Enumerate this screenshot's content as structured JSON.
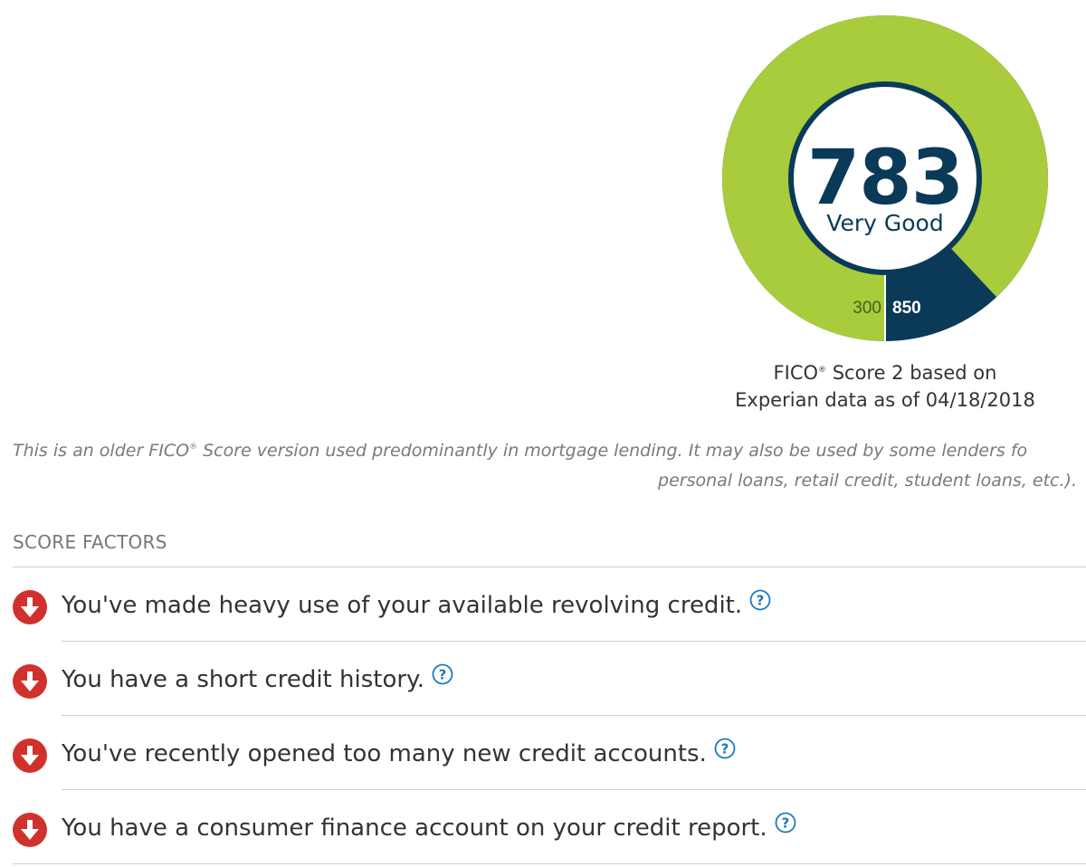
{
  "score_gauge": {
    "score": "783",
    "rating": "Very Good",
    "min_label": "300",
    "max_label": "850",
    "score_fraction": 0.88,
    "colors": {
      "fill": "#a8cc3c",
      "remaining": "#0a3a58",
      "inner_ring": "#0a3a58",
      "center": "#ffffff"
    }
  },
  "caption": {
    "brand": "FICO",
    "reg_mark": "®",
    "line1_rest": " Score 2 based on",
    "line2": "Experian data as of 04/18/2018"
  },
  "disclaimer": {
    "line1_a": "This is an older FICO",
    "reg_mark": "®",
    "line1_b": " Score version used predominantly in mortgage lending. It may also be used by some lenders fo",
    "line2": "personal loans, retail credit, student loans, etc.)."
  },
  "score_factors": {
    "title": "SCORE FACTORS",
    "items": [
      {
        "text": "You've made heavy use of your available revolving credit.",
        "icon": "arrow-down-icon",
        "help_icon": "question-circle-icon"
      },
      {
        "text": "You have a short credit history.",
        "icon": "arrow-down-icon",
        "help_icon": "question-circle-icon"
      },
      {
        "text": "You've recently opened too many new credit accounts.",
        "icon": "arrow-down-icon",
        "help_icon": "question-circle-icon"
      },
      {
        "text": "You have a consumer finance account on your credit report.",
        "icon": "arrow-down-icon",
        "help_icon": "question-circle-icon"
      }
    ]
  },
  "icon_colors": {
    "negative": "#d0312d",
    "help": "#1f7ab8"
  }
}
